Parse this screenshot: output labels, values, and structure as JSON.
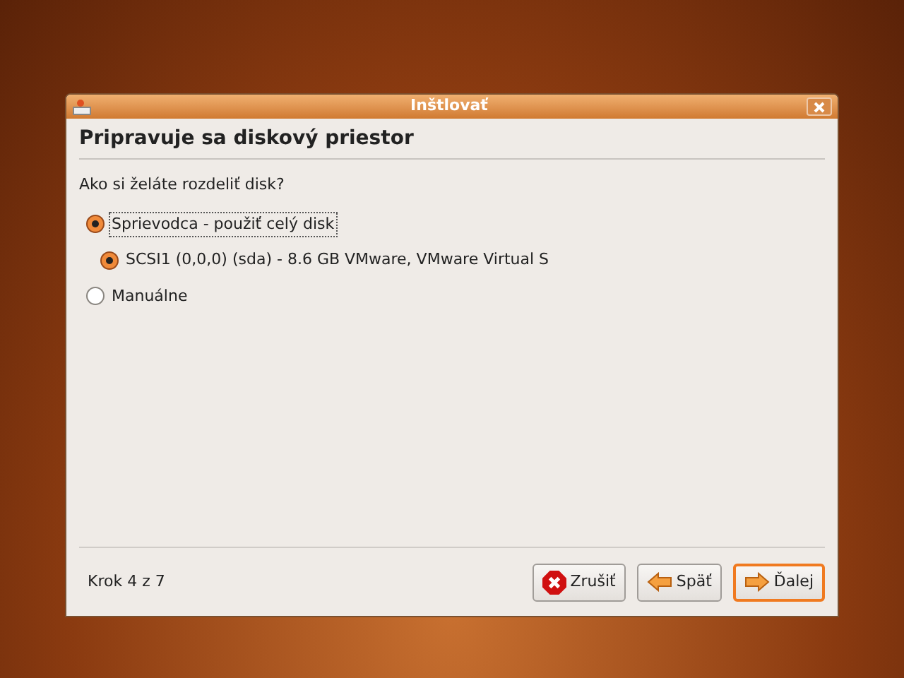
{
  "window": {
    "title": "Inštlovať"
  },
  "heading": "Pripravuje sa diskový priestor",
  "question": "Ako si želáte rozdeliť disk?",
  "options": [
    {
      "label": "Sprievodca - použiť celý disk",
      "selected": true,
      "focused": true,
      "children": [
        {
          "label": "SCSI1 (0,0,0) (sda) - 8.6 GB VMware, VMware Virtual S",
          "selected": true,
          "focused": false
        }
      ]
    },
    {
      "label": "Manuálne",
      "selected": false,
      "focused": false
    }
  ],
  "step": "Krok 4 z 7",
  "buttons": [
    {
      "label": "Zrušiť",
      "kind": "cancel",
      "default": false
    },
    {
      "label": "Späť",
      "kind": "back",
      "default": false
    },
    {
      "label": "Ďalej",
      "kind": "forward",
      "default": true
    }
  ]
}
